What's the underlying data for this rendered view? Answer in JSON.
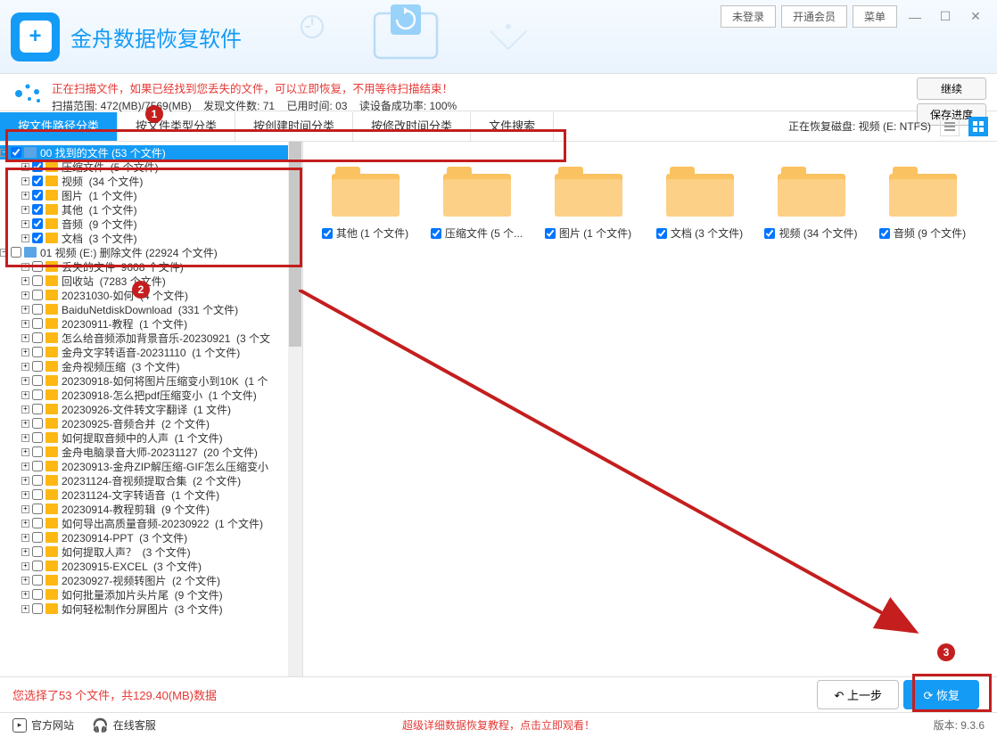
{
  "app_title": "金舟数据恢复软件",
  "header_buttons": {
    "login": "未登录",
    "vip": "开通会员",
    "menu": "菜单"
  },
  "status": {
    "line1": "正在扫描文件，如果已经找到您丢失的文件，可以立即恢复，不用等待扫描结束！",
    "scan_range": "扫描范围: 472(MB)/7569(MB)",
    "found": "发现文件数: 71",
    "elapsed": "已用时间: 03",
    "success_rate": "读设备成功率: 100%",
    "btn_continue": "继续",
    "btn_save": "保存进度"
  },
  "tabs": {
    "items": [
      "按文件路径分类",
      "按文件类型分类",
      "按创建时间分类",
      "按修改时间分类",
      "文件搜索"
    ],
    "disk": "正在恢复磁盘: 视频 (E: NTFS)"
  },
  "tree": {
    "root": "00 找到的文件  (53 个文件)",
    "group1": [
      {
        "name": "压缩文件",
        "count": "(5 个文件)"
      },
      {
        "name": "视频",
        "count": "(34 个文件)"
      },
      {
        "name": "图片",
        "count": "(1 个文件)"
      },
      {
        "name": "其他",
        "count": "(1 个文件)"
      },
      {
        "name": "音频",
        "count": "(9 个文件)"
      },
      {
        "name": "文档",
        "count": "(3 个文件)"
      }
    ],
    "section2": "01 视频 (E:) 删除文件  (22924 个文件)",
    "group2": [
      {
        "name": "丢失的文件",
        "count": "9608 个文件)"
      },
      {
        "name": "回收站",
        "count": "(7283 个文件)"
      },
      {
        "name": "20231030-如何",
        "count": "(4 个文件)"
      },
      {
        "name": "BaiduNetdiskDownload",
        "count": "(331 个文件)"
      },
      {
        "name": "20230911-教程",
        "count": "(1 个文件)"
      },
      {
        "name": "怎么给音频添加背景音乐-20230921",
        "count": "(3 个文"
      },
      {
        "name": "金舟文字转语音-20231110",
        "count": "(1 个文件)"
      },
      {
        "name": "金舟视频压缩",
        "count": "(3 个文件)"
      },
      {
        "name": "20230918-如何将图片压缩变小到10K",
        "count": "(1 个"
      },
      {
        "name": "20230918-怎么把pdf压缩变小",
        "count": "(1 个文件)"
      },
      {
        "name": "20230926-文件转文字翻译",
        "count": "(1 文件)"
      },
      {
        "name": "20230925-音频合并",
        "count": "(2 个文件)"
      },
      {
        "name": "如何提取音频中的人声",
        "count": "(1 个文件)"
      },
      {
        "name": "金舟电脑录音大师-20231127",
        "count": "(20 个文件)"
      },
      {
        "name": "20230913-金舟ZIP解压缩-GIF怎么压缩变小",
        "count": ""
      },
      {
        "name": "20231124-音视频提取合集",
        "count": "(2 个文件)"
      },
      {
        "name": "20231124-文字转语音",
        "count": "(1 个文件)"
      },
      {
        "name": "20230914-教程剪辑",
        "count": "(9 个文件)"
      },
      {
        "name": "如何导出高质量音频-20230922",
        "count": "(1 个文件)"
      },
      {
        "name": "20230914-PPT",
        "count": "(3 个文件)"
      },
      {
        "name": "如何提取人声？",
        "count": "(3 个文件)"
      },
      {
        "name": "20230915-EXCEL",
        "count": "(3 个文件)"
      },
      {
        "name": "20230927-视频转图片",
        "count": "(2 个文件)"
      },
      {
        "name": "如何批量添加片头片尾",
        "count": "(9 个文件)"
      },
      {
        "name": "如何轻松制作分屏图片",
        "count": "(3 个文件)"
      }
    ]
  },
  "grid": [
    {
      "name": "其他",
      "count": "(1 个文件)"
    },
    {
      "name": "压缩文件",
      "count": "(5 个..."
    },
    {
      "name": "图片",
      "count": "(1 个文件)"
    },
    {
      "name": "文档",
      "count": "(3 个文件)"
    },
    {
      "name": "视频",
      "count": "(34 个文件)"
    },
    {
      "name": "音频",
      "count": "(9 个文件)"
    }
  ],
  "annotations": {
    "n1": "1",
    "n2": "2",
    "n3": "3"
  },
  "footer": {
    "selection": "您选择了53 个文件，共129.40(MB)数据",
    "prev": "上一步",
    "recover": "恢复",
    "site": "官方网站",
    "support": "在线客服",
    "tutorial": "超级详细数据恢复教程，点击立即观看！",
    "version": "版本: 9.3.6"
  }
}
